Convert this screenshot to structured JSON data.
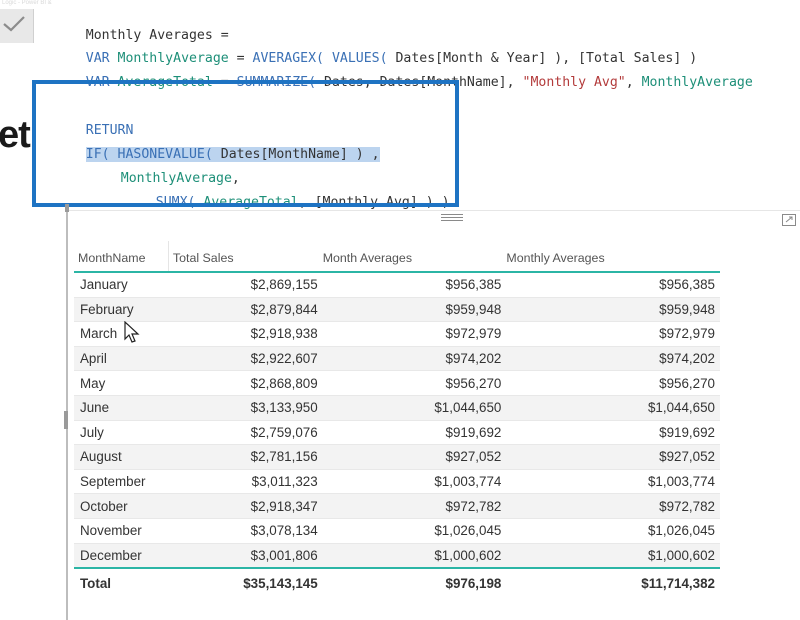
{
  "window": {
    "title": "Logic - Power BI & DAX"
  },
  "formula": {
    "line1": {
      "measure": "Monthly Averages",
      "eq": " ="
    },
    "line2": {
      "kw": "VAR",
      "var": "MonthlyAverage",
      "eq": " = ",
      "fn": "AVERAGEX(",
      "fn2": " VALUES(",
      "args": " Dates[Month & Year] ), [Total Sales] )"
    },
    "line3": {
      "kw": "VAR",
      "var": "AverageTotal",
      "eq": " = ",
      "fn": "SUMMARIZE(",
      "args": " Dates, Dates[MonthName], ",
      "str": "\"Monthly Avg\"",
      "comma": ", ",
      "var2": "MonthlyAverage"
    },
    "line4": {
      "kw": "RETURN"
    },
    "line5": {
      "fn": "IF(",
      "fn2": " HASONEVALUE(",
      "args": " Dates[MonthName] ) ,"
    },
    "line6": {
      "var": "MonthlyAverage",
      "comma": ","
    },
    "line7": {
      "fn": "SUMX(",
      "var": " AverageTotal",
      "args": ", [Monthly Avg] ) )"
    }
  },
  "background_heading": "et",
  "table": {
    "columns": [
      "MonthName",
      "Total Sales",
      "Month Averages",
      "Monthly Averages"
    ],
    "rows": [
      [
        "January",
        "$2,869,155",
        "$956,385",
        "$956,385"
      ],
      [
        "February",
        "$2,879,844",
        "$959,948",
        "$959,948"
      ],
      [
        "March",
        "$2,918,938",
        "$972,979",
        "$972,979"
      ],
      [
        "April",
        "$2,922,607",
        "$974,202",
        "$974,202"
      ],
      [
        "May",
        "$2,868,809",
        "$956,270",
        "$956,270"
      ],
      [
        "June",
        "$3,133,950",
        "$1,044,650",
        "$1,044,650"
      ],
      [
        "July",
        "$2,759,076",
        "$919,692",
        "$919,692"
      ],
      [
        "August",
        "$2,781,156",
        "$927,052",
        "$927,052"
      ],
      [
        "September",
        "$3,011,323",
        "$1,003,774",
        "$1,003,774"
      ],
      [
        "October",
        "$2,918,347",
        "$972,782",
        "$972,782"
      ],
      [
        "November",
        "$3,078,134",
        "$1,026,045",
        "$1,026,045"
      ],
      [
        "December",
        "$3,001,806",
        "$1,000,602",
        "$1,000,602"
      ]
    ],
    "total": [
      "Total",
      "$35,143,145",
      "$976,198",
      "$11,714,382"
    ]
  },
  "colors": {
    "highlight_border": "#1e73c3",
    "accent_teal": "#2bb5a5",
    "keyword": "#3a70b5",
    "variable": "#1d8f78",
    "string": "#b33b3b",
    "selection": "#bcd4ef"
  },
  "icons": {
    "commit": "checkmark-icon",
    "focus": "focus-mode-icon",
    "grip": "drag-grip-icon",
    "cursor": "mouse-cursor-icon"
  }
}
